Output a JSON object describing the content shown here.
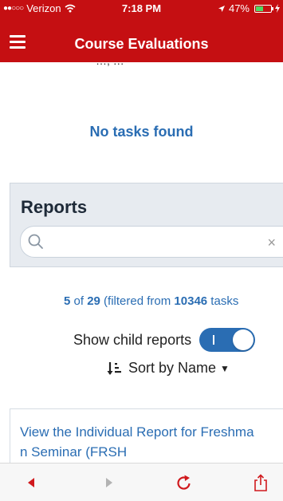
{
  "status_bar": {
    "carrier": "Verizon",
    "time": "7:18 PM",
    "battery": "47%",
    "icons": [
      "signal-dots-icon",
      "wifi-icon",
      "location-arrow-icon",
      "battery-icon",
      "charging-icon"
    ]
  },
  "header": {
    "title": "Course Evaluations",
    "menu_icon": "hamburger-menu-icon"
  },
  "clipped_text": "…, …",
  "empty_state": {
    "message": "No tasks found"
  },
  "reports": {
    "title": "Reports",
    "search": {
      "value": "",
      "placeholder": "",
      "search_icon": "search-icon",
      "clear_label": "×"
    }
  },
  "results": {
    "shown": "5",
    "of_word": " of ",
    "total": "29",
    "filtered_prefix": " (filtered from ",
    "filtered_total": "10346",
    "filtered_suffix": " tasks"
  },
  "child_reports": {
    "label": "Show child reports",
    "enabled": true
  },
  "sort": {
    "label": "Sort by Name",
    "icon": "sort-descending-icon",
    "caret": "▼"
  },
  "report_card": {
    "link_text": "View the Individual Report for Freshman Seminar (FRSH"
  },
  "bottom_toolbar": {
    "items": [
      {
        "name": "back-icon",
        "enabled": true
      },
      {
        "name": "forward-icon",
        "enabled": false
      },
      {
        "name": "reload-icon",
        "enabled": true
      },
      {
        "name": "share-icon",
        "enabled": true
      }
    ]
  },
  "colors": {
    "header_bg": "#c50f12",
    "accent_blue": "#2a6db3",
    "panel_bg": "#e7ebf0",
    "toolbar_red": "#d0191d"
  }
}
